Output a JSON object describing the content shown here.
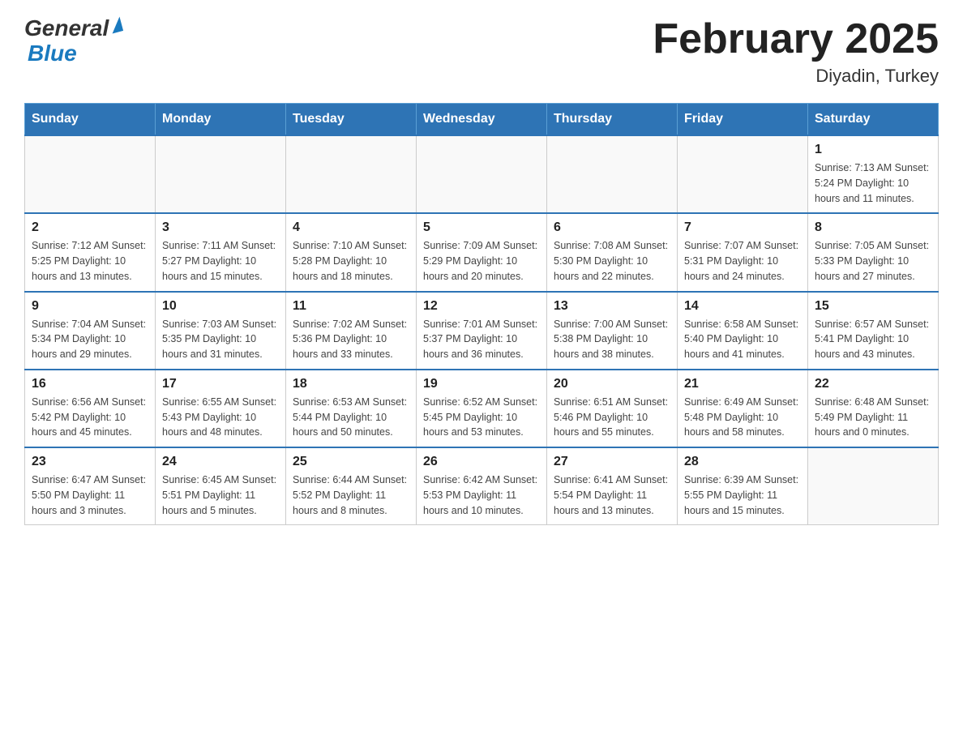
{
  "logo": {
    "text_general": "General",
    "text_blue": "Blue",
    "arrow": "▲"
  },
  "title": "February 2025",
  "location": "Diyadin, Turkey",
  "weekdays": [
    "Sunday",
    "Monday",
    "Tuesday",
    "Wednesday",
    "Thursday",
    "Friday",
    "Saturday"
  ],
  "weeks": [
    [
      {
        "day": "",
        "info": ""
      },
      {
        "day": "",
        "info": ""
      },
      {
        "day": "",
        "info": ""
      },
      {
        "day": "",
        "info": ""
      },
      {
        "day": "",
        "info": ""
      },
      {
        "day": "",
        "info": ""
      },
      {
        "day": "1",
        "info": "Sunrise: 7:13 AM\nSunset: 5:24 PM\nDaylight: 10 hours\nand 11 minutes."
      }
    ],
    [
      {
        "day": "2",
        "info": "Sunrise: 7:12 AM\nSunset: 5:25 PM\nDaylight: 10 hours\nand 13 minutes."
      },
      {
        "day": "3",
        "info": "Sunrise: 7:11 AM\nSunset: 5:27 PM\nDaylight: 10 hours\nand 15 minutes."
      },
      {
        "day": "4",
        "info": "Sunrise: 7:10 AM\nSunset: 5:28 PM\nDaylight: 10 hours\nand 18 minutes."
      },
      {
        "day": "5",
        "info": "Sunrise: 7:09 AM\nSunset: 5:29 PM\nDaylight: 10 hours\nand 20 minutes."
      },
      {
        "day": "6",
        "info": "Sunrise: 7:08 AM\nSunset: 5:30 PM\nDaylight: 10 hours\nand 22 minutes."
      },
      {
        "day": "7",
        "info": "Sunrise: 7:07 AM\nSunset: 5:31 PM\nDaylight: 10 hours\nand 24 minutes."
      },
      {
        "day": "8",
        "info": "Sunrise: 7:05 AM\nSunset: 5:33 PM\nDaylight: 10 hours\nand 27 minutes."
      }
    ],
    [
      {
        "day": "9",
        "info": "Sunrise: 7:04 AM\nSunset: 5:34 PM\nDaylight: 10 hours\nand 29 minutes."
      },
      {
        "day": "10",
        "info": "Sunrise: 7:03 AM\nSunset: 5:35 PM\nDaylight: 10 hours\nand 31 minutes."
      },
      {
        "day": "11",
        "info": "Sunrise: 7:02 AM\nSunset: 5:36 PM\nDaylight: 10 hours\nand 33 minutes."
      },
      {
        "day": "12",
        "info": "Sunrise: 7:01 AM\nSunset: 5:37 PM\nDaylight: 10 hours\nand 36 minutes."
      },
      {
        "day": "13",
        "info": "Sunrise: 7:00 AM\nSunset: 5:38 PM\nDaylight: 10 hours\nand 38 minutes."
      },
      {
        "day": "14",
        "info": "Sunrise: 6:58 AM\nSunset: 5:40 PM\nDaylight: 10 hours\nand 41 minutes."
      },
      {
        "day": "15",
        "info": "Sunrise: 6:57 AM\nSunset: 5:41 PM\nDaylight: 10 hours\nand 43 minutes."
      }
    ],
    [
      {
        "day": "16",
        "info": "Sunrise: 6:56 AM\nSunset: 5:42 PM\nDaylight: 10 hours\nand 45 minutes."
      },
      {
        "day": "17",
        "info": "Sunrise: 6:55 AM\nSunset: 5:43 PM\nDaylight: 10 hours\nand 48 minutes."
      },
      {
        "day": "18",
        "info": "Sunrise: 6:53 AM\nSunset: 5:44 PM\nDaylight: 10 hours\nand 50 minutes."
      },
      {
        "day": "19",
        "info": "Sunrise: 6:52 AM\nSunset: 5:45 PM\nDaylight: 10 hours\nand 53 minutes."
      },
      {
        "day": "20",
        "info": "Sunrise: 6:51 AM\nSunset: 5:46 PM\nDaylight: 10 hours\nand 55 minutes."
      },
      {
        "day": "21",
        "info": "Sunrise: 6:49 AM\nSunset: 5:48 PM\nDaylight: 10 hours\nand 58 minutes."
      },
      {
        "day": "22",
        "info": "Sunrise: 6:48 AM\nSunset: 5:49 PM\nDaylight: 11 hours\nand 0 minutes."
      }
    ],
    [
      {
        "day": "23",
        "info": "Sunrise: 6:47 AM\nSunset: 5:50 PM\nDaylight: 11 hours\nand 3 minutes."
      },
      {
        "day": "24",
        "info": "Sunrise: 6:45 AM\nSunset: 5:51 PM\nDaylight: 11 hours\nand 5 minutes."
      },
      {
        "day": "25",
        "info": "Sunrise: 6:44 AM\nSunset: 5:52 PM\nDaylight: 11 hours\nand 8 minutes."
      },
      {
        "day": "26",
        "info": "Sunrise: 6:42 AM\nSunset: 5:53 PM\nDaylight: 11 hours\nand 10 minutes."
      },
      {
        "day": "27",
        "info": "Sunrise: 6:41 AM\nSunset: 5:54 PM\nDaylight: 11 hours\nand 13 minutes."
      },
      {
        "day": "28",
        "info": "Sunrise: 6:39 AM\nSunset: 5:55 PM\nDaylight: 11 hours\nand 15 minutes."
      },
      {
        "day": "",
        "info": ""
      }
    ]
  ]
}
